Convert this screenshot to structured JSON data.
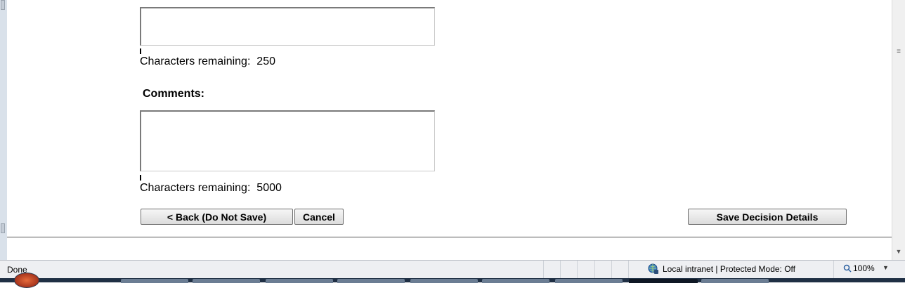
{
  "form": {
    "first_field_remaining_label": "Characters remaining:",
    "first_field_remaining_value": "250",
    "comments_heading": "Comments:",
    "comments_remaining_label": "Characters remaining:",
    "comments_remaining_value": "5000",
    "back_button": "< Back (Do Not Save)",
    "cancel_button": "Cancel",
    "save_button": "Save Decision Details"
  },
  "statusbar": {
    "status_text": "Done",
    "zone_text": "Local intranet | Protected Mode: Off",
    "zoom_text": "100%",
    "zone_icon": "globe-shield-icon",
    "zoom_icon": "magnifier-icon"
  }
}
